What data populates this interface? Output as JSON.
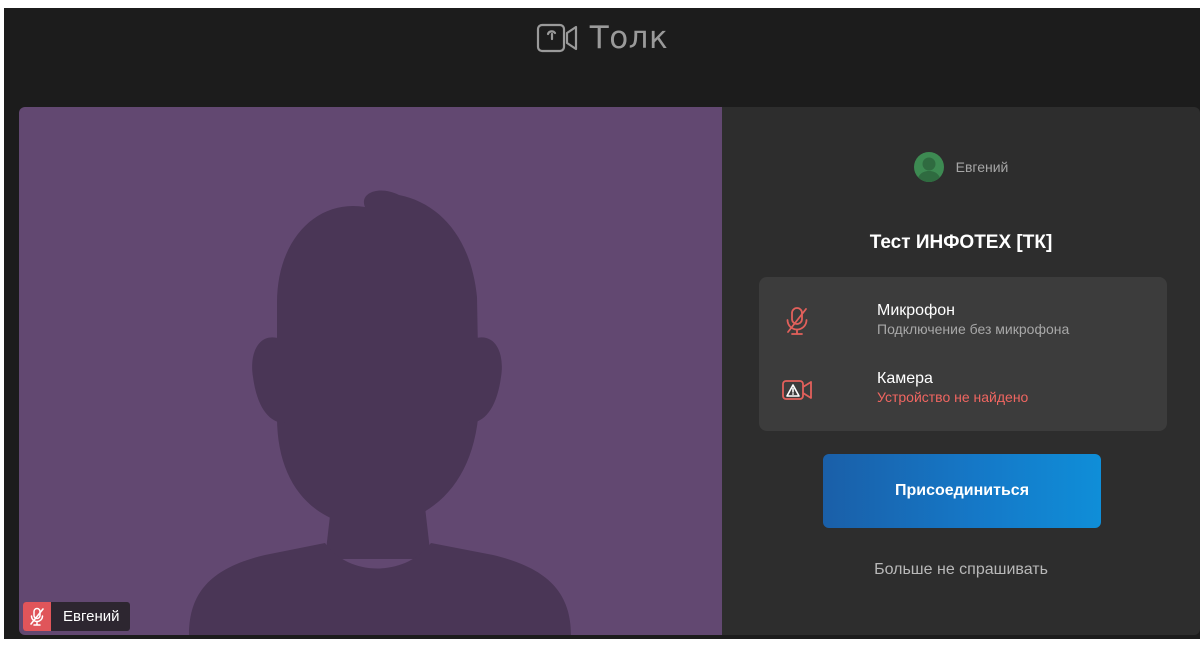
{
  "app": {
    "name": "Толк"
  },
  "video": {
    "participant_name": "Евгений",
    "background_color": "#624871",
    "silhouette_color": "#4a3656",
    "mic_state": "muted"
  },
  "panel": {
    "user_name": "Евгений",
    "avatar_color": "#3d8a52",
    "meeting_title": "Тест ИНФОТЕХ [ТК]",
    "devices": {
      "microphone": {
        "title": "Микрофон",
        "status": "Подключение без микрофона",
        "icon": "mic-off-icon"
      },
      "camera": {
        "title": "Камера",
        "status": "Устройство не найдено",
        "icon": "camera-warning-icon"
      }
    },
    "join_label": "Присоединиться",
    "dont_ask_label": "Больше не спрашивать"
  },
  "colors": {
    "accent": "#1578c7",
    "error": "#f06661",
    "panel_bg": "#2d2d2d",
    "app_bg": "#1c1c1c"
  }
}
